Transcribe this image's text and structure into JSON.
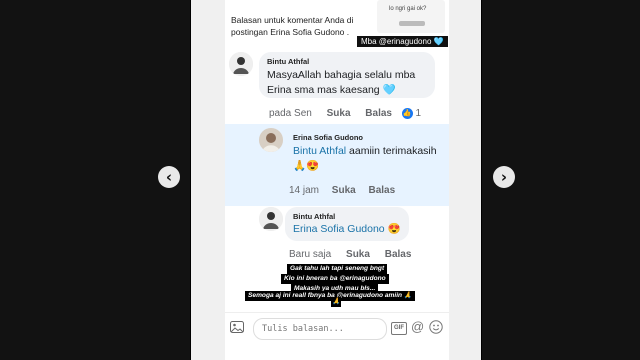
{
  "carousel": {
    "prev_icon": "chevron-left-icon",
    "next_icon": "chevron-right-icon",
    "prev_glyph": "‹",
    "next_glyph": "›"
  },
  "top_card": {
    "text": "lo ngri gai ok?"
  },
  "notice": {
    "line1": "Balasan untuk komentar Anda di",
    "line2": "postingan Erina Sofia Gudono ."
  },
  "mention_sticker": {
    "text": "Mba @erinagudono",
    "emoji": "🩵"
  },
  "comments": [
    {
      "author": "Bintu Athfal",
      "text": "MasyaAllah bahagia selalu mba Erina sma mas kaesang",
      "emoji": "🩵",
      "time": "pada Sen",
      "like": "Suka",
      "reply": "Balas",
      "reactions": "1"
    },
    {
      "author": "Erina Sofia Gudono",
      "mention": "Bintu Athfal",
      "text": " aamiin terimakasih",
      "emoji": "🙏😍",
      "time": "14 jam",
      "like": "Suka",
      "reply": "Balas"
    },
    {
      "author": "Bintu Athfal",
      "mention": "Erina Sofia Gudono",
      "emoji": "😍",
      "time": "Baru saja",
      "like": "Suka",
      "reply": "Balas"
    }
  ],
  "stickers": [
    "Gak tahu lah tapi seneng bngt",
    "Klo ini bneran ba @erinagudono",
    "Makasih ya udh mau bls...",
    "Semoga aj ini reall fbnya ba @erinagudono  amiin 🙏",
    "🙏"
  ],
  "reply_bar": {
    "placeholder": "Tulis balasan...",
    "gif": "GIF",
    "at": "@"
  },
  "colors": {
    "accent": "#1877f2",
    "highlight": "#e7f3ff",
    "bubble": "#f0f2f5",
    "mention": "#1a73a8"
  }
}
